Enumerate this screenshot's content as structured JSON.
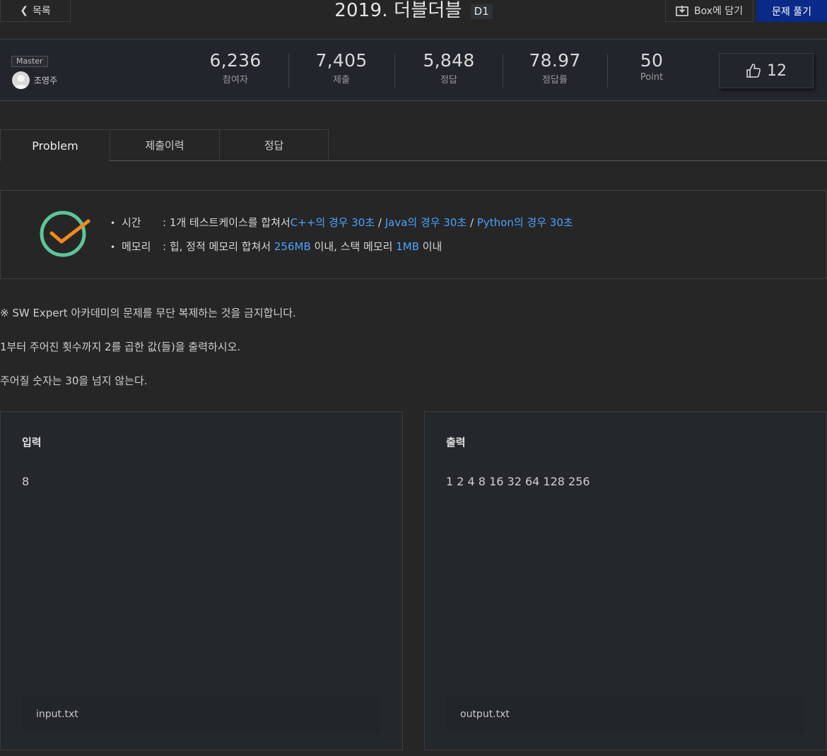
{
  "header": {
    "back_label": "목록",
    "title": "2019. 더블더블",
    "level": "D1",
    "box_label": "Box에 담기",
    "solve_label": "문제 풀기"
  },
  "stats": {
    "rank": "Master",
    "author": "조영주",
    "participants_value": "6,236",
    "participants_label": "참여자",
    "submissions_value": "7,405",
    "submissions_label": "제출",
    "correct_value": "5,848",
    "correct_label": "정답",
    "rate_value": "78.97",
    "rate_label": "정답률",
    "point_value": "50",
    "point_label": "Point",
    "likes": "12"
  },
  "tabs": [
    {
      "label": "Problem"
    },
    {
      "label": "제출이력"
    },
    {
      "label": "정답"
    }
  ],
  "limits": {
    "time_label": "시간",
    "time_prefix": ": 1개 테스트케이스를 합쳐서 ",
    "time_cpp": "C++의 경우 30초",
    "time_java": "Java의 경우 30초",
    "time_python": "Python의 경우 30초",
    "sep": " / ",
    "memory_label": "메모리",
    "memory_prefix": ": 힙, 정적 메모리 합쳐서 ",
    "memory_heap": "256MB",
    "memory_mid": " 이내, 스택 메모리 ",
    "memory_stack": "1MB",
    "memory_suffix": " 이내"
  },
  "statement": {
    "notice": "※ SW Expert 아카데미의 문제를 무단 복제하는 것을 금지합니다.",
    "line1": "1부터 주어진 횟수까지 2를 곱한 값(들)을 출력하시오.",
    "line2": "주어질 숫자는 30을 넘지 않는다."
  },
  "input": {
    "title": "입력",
    "value": "8",
    "file": "input.txt"
  },
  "output": {
    "title": "출력",
    "value": "1 2 4 8 16 32 64 128 256",
    "file": "output.txt"
  },
  "colors": {
    "accent_blue": "#4aa3ff",
    "solve_button": "#0a2a88",
    "clock_green": "#5ec49a",
    "clock_orange": "#f08a1c"
  }
}
